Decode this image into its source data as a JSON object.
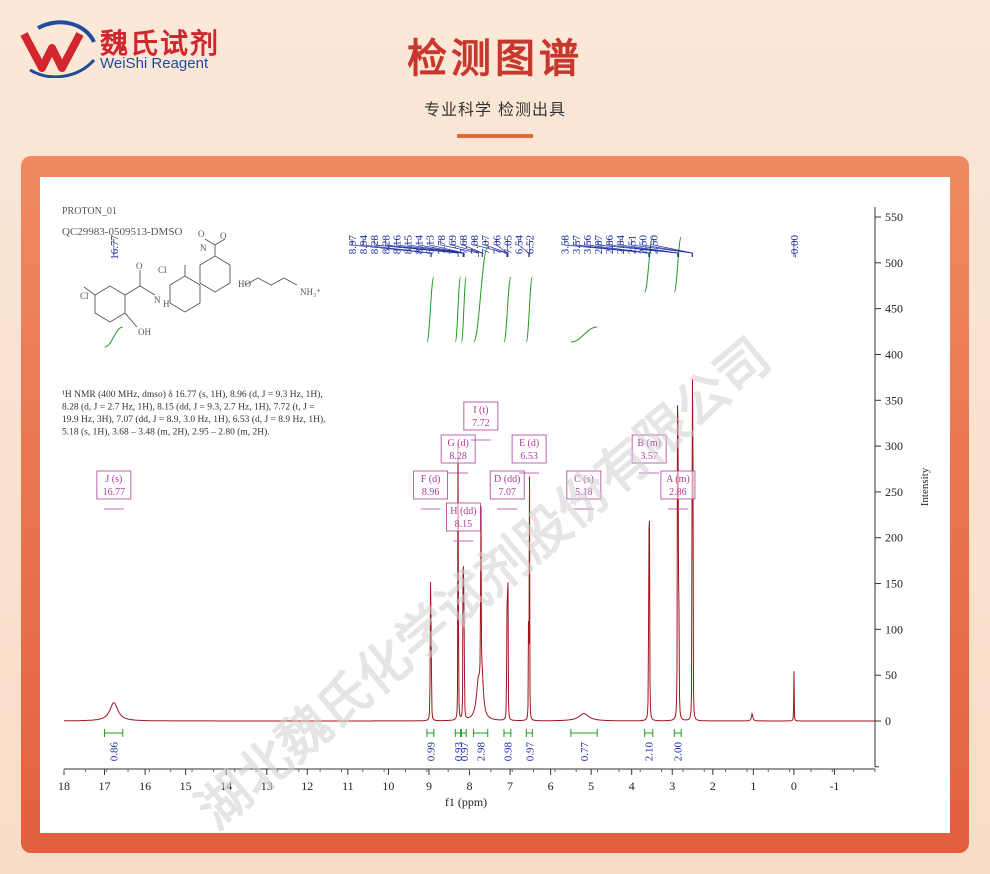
{
  "header": {
    "brand_cn": "魏氏试剂",
    "brand_en": "WeiShi Reagent",
    "title": "检测图谱",
    "subtitle": "专业科学  检测出具"
  },
  "watermark": "湖北魏氏化学试剂股份有限公司",
  "colors": {
    "brand_red": "#d1262d",
    "brand_blue": "#1e4b9b",
    "spectrum": "#a0161c",
    "integral": "#1f9a1f",
    "peak_label": "#1f2fa0",
    "multiplet": "#b03aa0"
  },
  "chart_data": {
    "type": "line",
    "sample_line1": "PROTON_01",
    "sample_line2": "QC29983-0509513-DMSO",
    "xlabel": "f1 (ppm)",
    "ylabel": "Intensity",
    "xlim": [
      18,
      -2
    ],
    "ylim": [
      -50,
      560
    ],
    "x_ticks": [
      "18",
      "17",
      "16",
      "15",
      "14",
      "13",
      "12",
      "11",
      "10",
      "9",
      "8",
      "7",
      "6",
      "5",
      "4",
      "3",
      "2",
      "1",
      "0",
      "-1"
    ],
    "y_ticks": [
      "550",
      "500",
      "450",
      "400",
      "350",
      "300",
      "250",
      "200",
      "150",
      "100",
      "50",
      "0"
    ],
    "peak_labels": [
      "16.77",
      "8.97",
      "8.94",
      "8.28",
      "8.28",
      "8.16",
      "8.15",
      "8.14",
      "8.13",
      "7.78",
      "7.69",
      "7.68",
      "7.08",
      "7.07",
      "7.06",
      "7.05",
      "6.54",
      "6.52",
      "3.58",
      "3.57",
      "3.56",
      "2.87",
      "2.86",
      "2.84",
      "2.51",
      "2.50",
      "2.50",
      "-0.00"
    ],
    "peaks": [
      {
        "ppm": 16.77,
        "height": 20,
        "width": 0.12
      },
      {
        "ppm": 8.965,
        "height": 230,
        "width": 0.004
      },
      {
        "ppm": 8.945,
        "height": 225,
        "width": 0.004
      },
      {
        "ppm": 8.283,
        "height": 245,
        "width": 0.004
      },
      {
        "ppm": 8.277,
        "height": 240,
        "width": 0.004
      },
      {
        "ppm": 8.16,
        "height": 135,
        "width": 0.004
      },
      {
        "ppm": 8.15,
        "height": 150,
        "width": 0.004
      },
      {
        "ppm": 8.14,
        "height": 140,
        "width": 0.004
      },
      {
        "ppm": 8.13,
        "height": 130,
        "width": 0.004
      },
      {
        "ppm": 7.78,
        "height": 40,
        "width": 0.06
      },
      {
        "ppm": 7.72,
        "height": 255,
        "width": 0.006
      },
      {
        "ppm": 7.69,
        "height": 40,
        "width": 0.04
      },
      {
        "ppm": 7.08,
        "height": 140,
        "width": 0.004
      },
      {
        "ppm": 7.07,
        "height": 145,
        "width": 0.004
      },
      {
        "ppm": 7.06,
        "height": 130,
        "width": 0.004
      },
      {
        "ppm": 7.05,
        "height": 125,
        "width": 0.004
      },
      {
        "ppm": 6.54,
        "height": 262,
        "width": 0.004
      },
      {
        "ppm": 6.52,
        "height": 258,
        "width": 0.004
      },
      {
        "ppm": 5.18,
        "height": 8,
        "width": 0.15
      },
      {
        "ppm": 3.58,
        "height": 160,
        "width": 0.005
      },
      {
        "ppm": 3.57,
        "height": 190,
        "width": 0.005
      },
      {
        "ppm": 3.56,
        "height": 170,
        "width": 0.005
      },
      {
        "ppm": 2.87,
        "height": 285,
        "width": 0.005
      },
      {
        "ppm": 2.86,
        "height": 300,
        "width": 0.005
      },
      {
        "ppm": 2.84,
        "height": 280,
        "width": 0.005
      },
      {
        "ppm": 2.51,
        "height": 290,
        "width": 0.004
      },
      {
        "ppm": 2.5,
        "height": 300,
        "width": 0.004
      },
      {
        "ppm": 2.49,
        "height": 285,
        "width": 0.004
      },
      {
        "ppm": 1.03,
        "height": 8,
        "width": 0.02
      },
      {
        "ppm": 0.0,
        "height": 75,
        "width": 0.004
      }
    ],
    "integrals": [
      {
        "from": 17.0,
        "to": 16.55,
        "value": "0.86"
      },
      {
        "from": 9.05,
        "to": 8.88,
        "value": "0.99"
      },
      {
        "from": 8.35,
        "to": 8.22,
        "value": "0.93"
      },
      {
        "from": 8.2,
        "to": 8.08,
        "value": "0.97"
      },
      {
        "from": 7.9,
        "to": 7.55,
        "value": "2.98"
      },
      {
        "from": 7.15,
        "to": 6.98,
        "value": "0.98"
      },
      {
        "from": 6.6,
        "to": 6.45,
        "value": "0.97"
      },
      {
        "from": 5.5,
        "to": 4.85,
        "value": "0.77"
      },
      {
        "from": 3.68,
        "to": 3.48,
        "value": "2.10"
      },
      {
        "from": 2.95,
        "to": 2.78,
        "value": "2.00"
      }
    ],
    "multiplets": [
      {
        "id": "J (s)",
        "shift": "16.77",
        "ppm": 16.77
      },
      {
        "id": "F (d)",
        "shift": "8.96",
        "ppm": 8.96
      },
      {
        "id": "G (d)",
        "shift": "8.28",
        "ppm": 8.28
      },
      {
        "id": "H (dd)",
        "shift": "8.15",
        "ppm": 8.15
      },
      {
        "id": "I (t)",
        "shift": "7.72",
        "ppm": 7.72
      },
      {
        "id": "D (dd)",
        "shift": "7.07",
        "ppm": 7.07
      },
      {
        "id": "E (d)",
        "shift": "6.53",
        "ppm": 6.53
      },
      {
        "id": "C (s)",
        "shift": "5.18",
        "ppm": 5.18
      },
      {
        "id": "B (m)",
        "shift": "3.57",
        "ppm": 3.57
      },
      {
        "id": "A (m)",
        "shift": "2.86",
        "ppm": 2.86
      }
    ],
    "nmr_text": [
      "¹H NMR (400 MHz, dmso) δ 16.77 (s, 1H), 8.96 (d, J = 9.3 Hz, 1H),",
      "8.28 (d, J = 2.7 Hz, 1H), 8.15 (dd, J = 9.3, 2.7 Hz, 1H), 7.72 (t, J =",
      "19.9 Hz, 3H), 7.07 (dd, J = 8.9, 3.0 Hz, 1H), 6.53 (d, J = 8.9 Hz, 1H),",
      "5.18 (s, 1H), 3.68 – 3.48 (m, 2H), 2.95 – 2.80 (m, 2H)."
    ],
    "structure_labels": [
      "Cl",
      "Cl",
      "O",
      "N",
      "H",
      "OH",
      "N",
      "O",
      "O",
      "HO",
      "NH₃⁺"
    ],
    "grid": false
  }
}
